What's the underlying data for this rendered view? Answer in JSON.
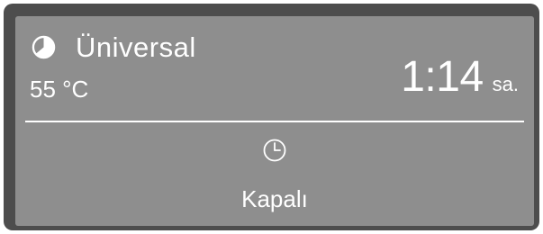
{
  "display": {
    "program": {
      "icon": "program-pie-icon",
      "name": "Üniversal"
    },
    "temperature": "55 °C",
    "remaining_time": {
      "value": "1:14",
      "unit": "sa."
    },
    "timer": {
      "icon": "clock-icon",
      "status": "Kapalı"
    }
  },
  "colors": {
    "screen_background": "#8e8e8e",
    "bezel": "#4d4d4d",
    "text": "#ffffff"
  }
}
